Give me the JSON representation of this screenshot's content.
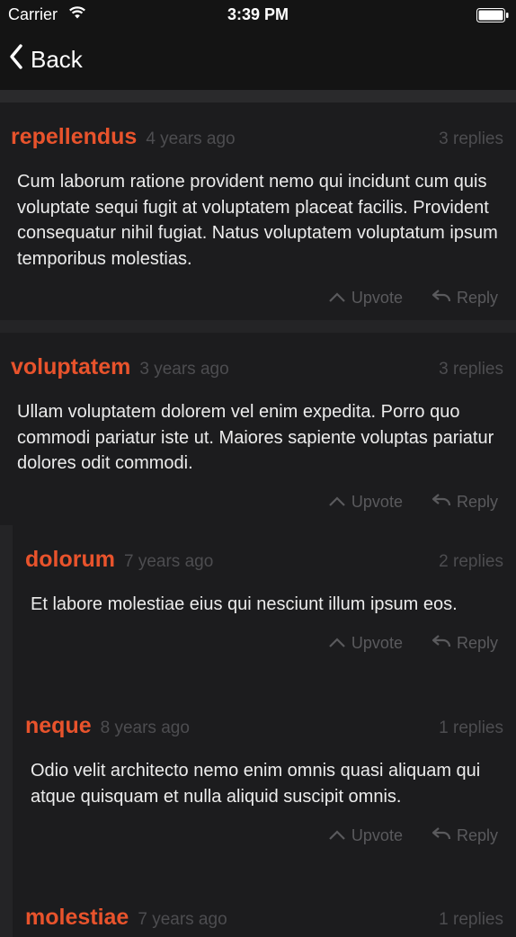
{
  "status": {
    "carrier": "Carrier",
    "time": "3:39 PM"
  },
  "nav": {
    "back_label": "Back"
  },
  "actions": {
    "upvote": "Upvote",
    "reply": "Reply"
  },
  "comments": [
    {
      "author": "repellendus",
      "age": "4 years ago",
      "replies": "3 replies",
      "body": "Cum laborum ratione provident nemo qui incidunt cum quis voluptate sequi fugit at voluptatem placeat facilis. Provident consequatur nihil fugiat. Natus voluptatem voluptatum ipsum temporibus molestias."
    },
    {
      "author": "voluptatem",
      "age": "3 years ago",
      "replies": "3 replies",
      "body": "Ullam voluptatem dolorem vel enim expedita. Porro quo commodi pariatur iste ut. Maiores sapiente voluptas pariatur dolores odit commodi."
    }
  ],
  "replies": [
    {
      "author": "dolorum",
      "age": "7 years ago",
      "replies": "2 replies",
      "body": "Et labore molestiae eius qui nesciunt illum ipsum eos."
    },
    {
      "author": "neque",
      "age": "8 years ago",
      "replies": "1 replies",
      "body": "Odio velit architecto nemo enim omnis quasi aliquam qui atque quisquam et nulla aliquid suscipit omnis."
    },
    {
      "author": "molestiae",
      "age": "7 years ago",
      "replies": "1 replies",
      "body": ""
    }
  ]
}
